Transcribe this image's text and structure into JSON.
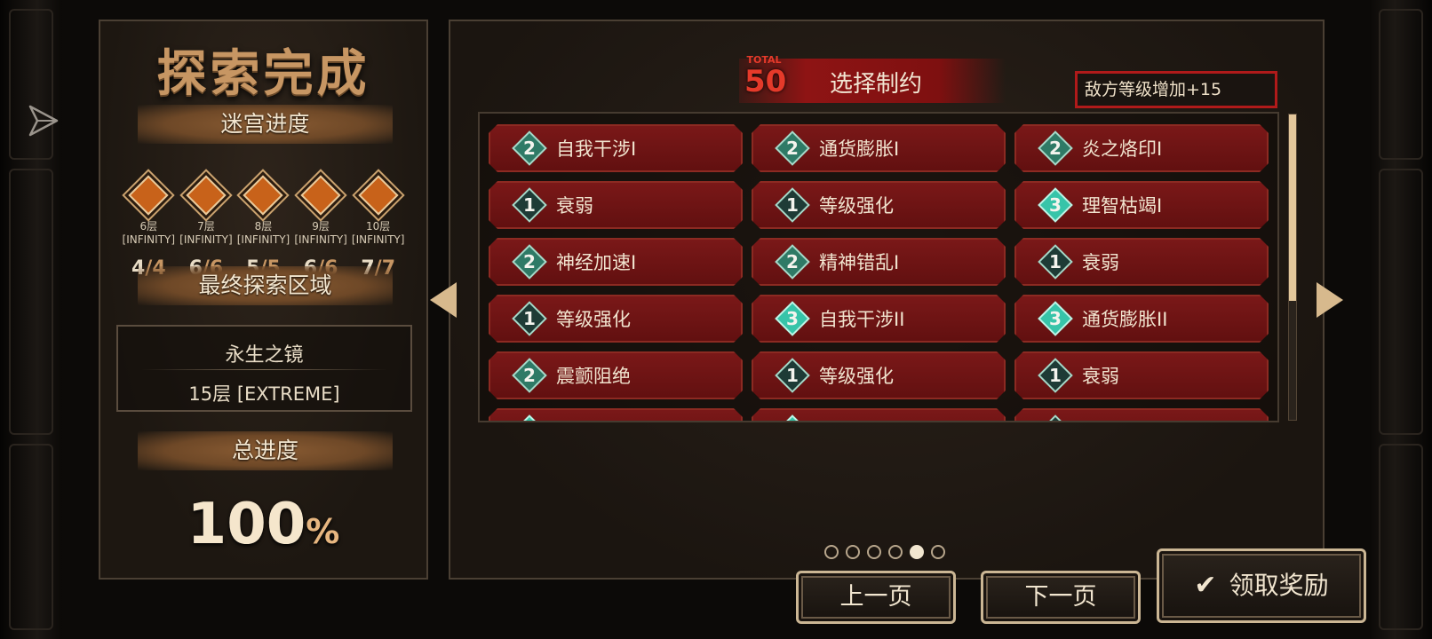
{
  "left": {
    "title": "探索完成",
    "maze_progress_title": "迷宫进度",
    "floors": [
      {
        "name": "6层",
        "difficulty": "[INFINITY]",
        "done": "4",
        "total": "/4"
      },
      {
        "name": "7层",
        "difficulty": "[INFINITY]",
        "done": "6",
        "total": "/6"
      },
      {
        "name": "8层",
        "difficulty": "[INFINITY]",
        "done": "5",
        "total": "/5"
      },
      {
        "name": "9层",
        "difficulty": "[INFINITY]",
        "done": "6",
        "total": "/6"
      },
      {
        "name": "10层",
        "difficulty": "[INFINITY]",
        "done": "7",
        "total": "/7"
      }
    ],
    "final_area_title": "最终探索区域",
    "final_area_name": "永生之镜",
    "final_area_floor": "15层 [EXTREME]",
    "total_progress_title": "总进度",
    "total_progress_value": "100",
    "total_progress_unit": "%"
  },
  "right": {
    "total_label": "TOTAL",
    "total_value": "50",
    "title": "选择制约",
    "enemy_level": "敌方等级增加+15",
    "restrictions": [
      {
        "level": "2",
        "label": "自我干涉I"
      },
      {
        "level": "2",
        "label": "通货膨胀I"
      },
      {
        "level": "2",
        "label": "炎之烙印I"
      },
      {
        "level": "1",
        "label": "衰弱"
      },
      {
        "level": "1",
        "label": "等级强化"
      },
      {
        "level": "3",
        "label": "理智枯竭I"
      },
      {
        "level": "2",
        "label": "神经加速I"
      },
      {
        "level": "2",
        "label": "精神错乱I"
      },
      {
        "level": "1",
        "label": "衰弱"
      },
      {
        "level": "1",
        "label": "等级强化"
      },
      {
        "level": "3",
        "label": "自我干涉II"
      },
      {
        "level": "3",
        "label": "通货膨胀II"
      },
      {
        "level": "2",
        "label": "震颤阻绝"
      },
      {
        "level": "1",
        "label": "等级强化"
      },
      {
        "level": "1",
        "label": "衰弱"
      }
    ],
    "page_count": 6,
    "active_page": 5,
    "scroll_position": 0.0
  },
  "buttons": {
    "prev": "上一页",
    "next": "下一页",
    "claim": "领取奖励"
  },
  "colors": {
    "accent": "#c79663",
    "card_red": "#7a1818",
    "alert_red": "#b01a1a"
  }
}
